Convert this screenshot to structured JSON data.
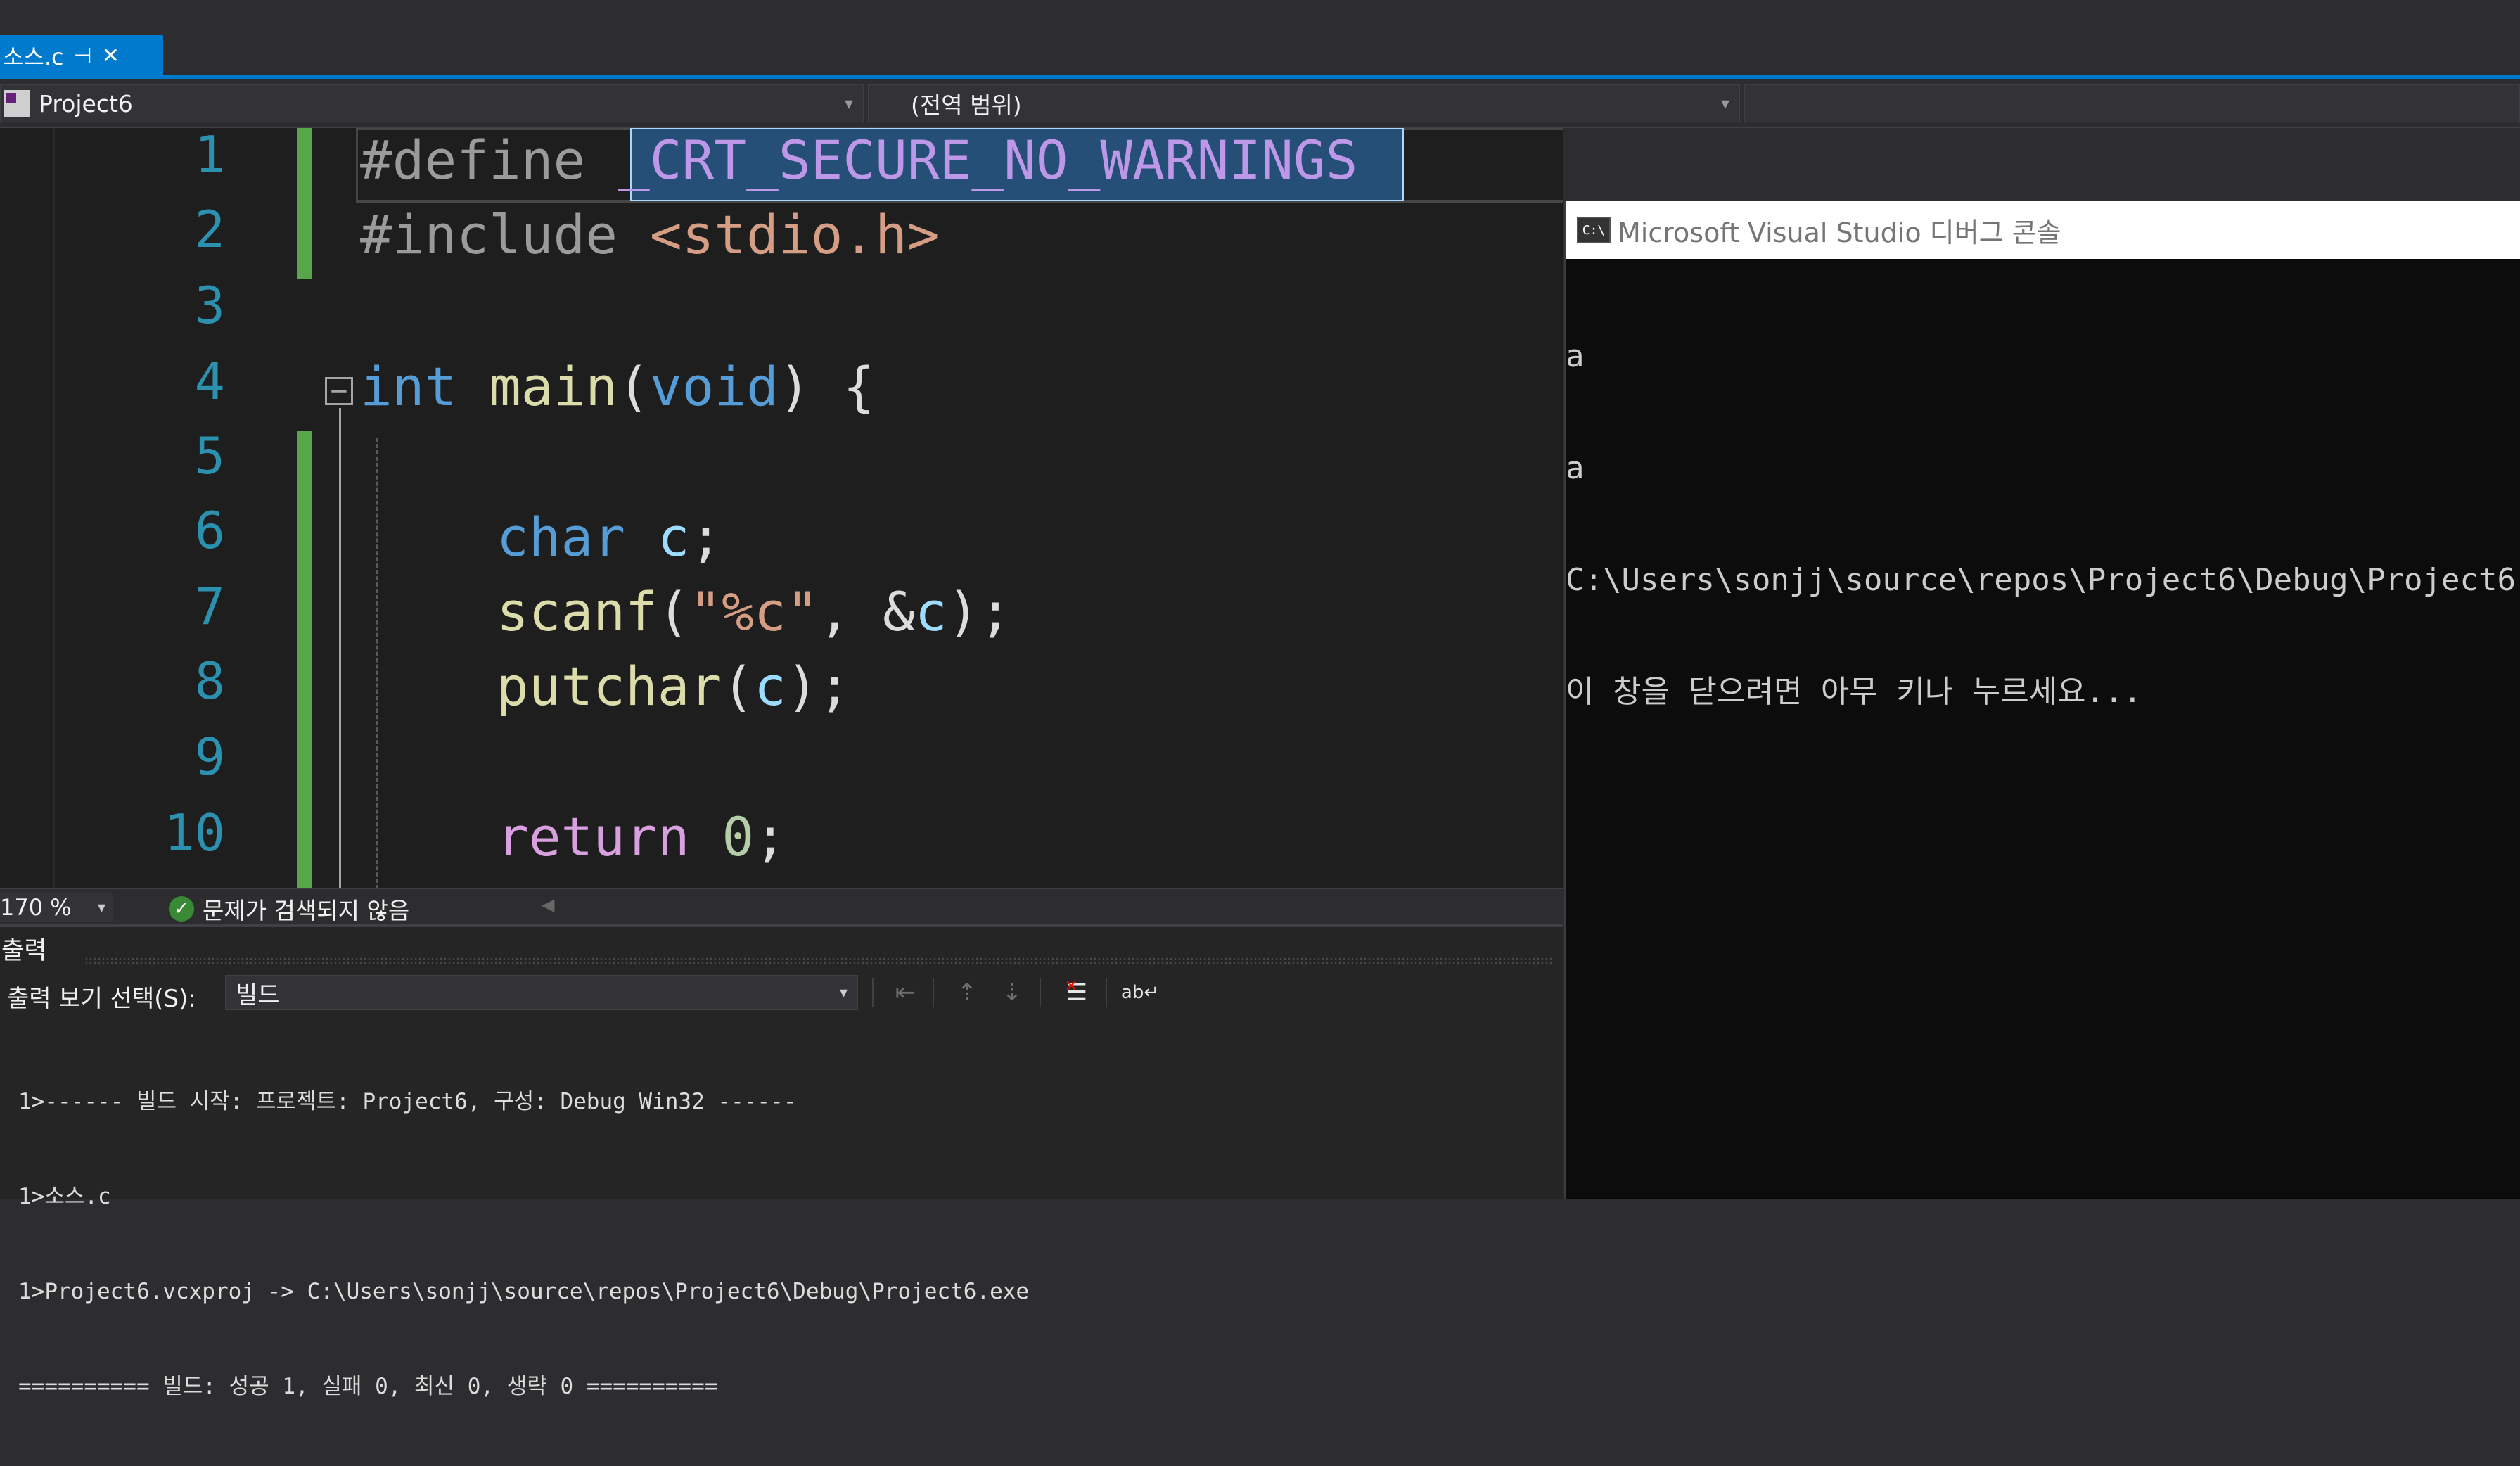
{
  "tab": {
    "label": "소스.c",
    "pin_icon": "pin-icon",
    "close_icon": "close-icon"
  },
  "navbar": {
    "project": "Project6",
    "scope": "(전역 범위)",
    "member": ""
  },
  "editor": {
    "line_numbers": [
      "1",
      "2",
      "3",
      "4",
      "5",
      "6",
      "7",
      "8",
      "9",
      "10"
    ],
    "lines": {
      "l1_pp": "#define ",
      "l1_macro": "_CRT_SECURE_NO_WARNINGS",
      "l2_pp": "#include ",
      "l2_hdr": "<stdio.h>",
      "l4_kw": "int",
      "l4_fn": "main",
      "l4_p1": "(",
      "l4_kw2": "void",
      "l4_p2": ") {",
      "l6_kw": "char",
      "l6_var": "c",
      "l6_end": ";",
      "l7_fn": "scanf",
      "l7_p1": "(",
      "l7_str": "\"%c\"",
      "l7_p2": ", &",
      "l7_var": "c",
      "l7_end": ");",
      "l8_fn": "putchar",
      "l8_p1": "(",
      "l8_var": "c",
      "l8_end": ");",
      "l10_kw": "return",
      "l10_num": "0",
      "l10_end": ";"
    },
    "fold_glyph": "−"
  },
  "status": {
    "zoom": "170 %",
    "issues": "문제가 검색되지 않음",
    "check_glyph": "✓"
  },
  "output": {
    "title": "출력",
    "show_label": "출력 보기 선택(S):",
    "show_value": "빌드",
    "lines": [
      "1>------ 빌드 시작: 프로젝트: Project6, 구성: Debug Win32 ------",
      "1>소스.c",
      "1>Project6.vcxproj -> C:\\Users\\sonjj\\source\\repos\\Project6\\Debug\\Project6.exe",
      "========== 빌드: 성공 1, 실패 0, 최신 0, 생략 0 =========="
    ]
  },
  "console": {
    "icon_text": "C:\\",
    "title": "Microsoft Visual Studio 디버그 콘솔",
    "lines": [
      "a",
      "a",
      "C:\\Users\\sonjj\\source\\repos\\Project6\\Debug\\Project6",
      "이 창을 닫으려면 아무 키나 누르세요..."
    ]
  },
  "colors": {
    "accent": "#007acc",
    "editor_bg": "#1e1e1e",
    "keyword": "#569cd6",
    "function": "#dcdcaa",
    "string": "#d69d85",
    "change_bar": "#57a64a"
  }
}
